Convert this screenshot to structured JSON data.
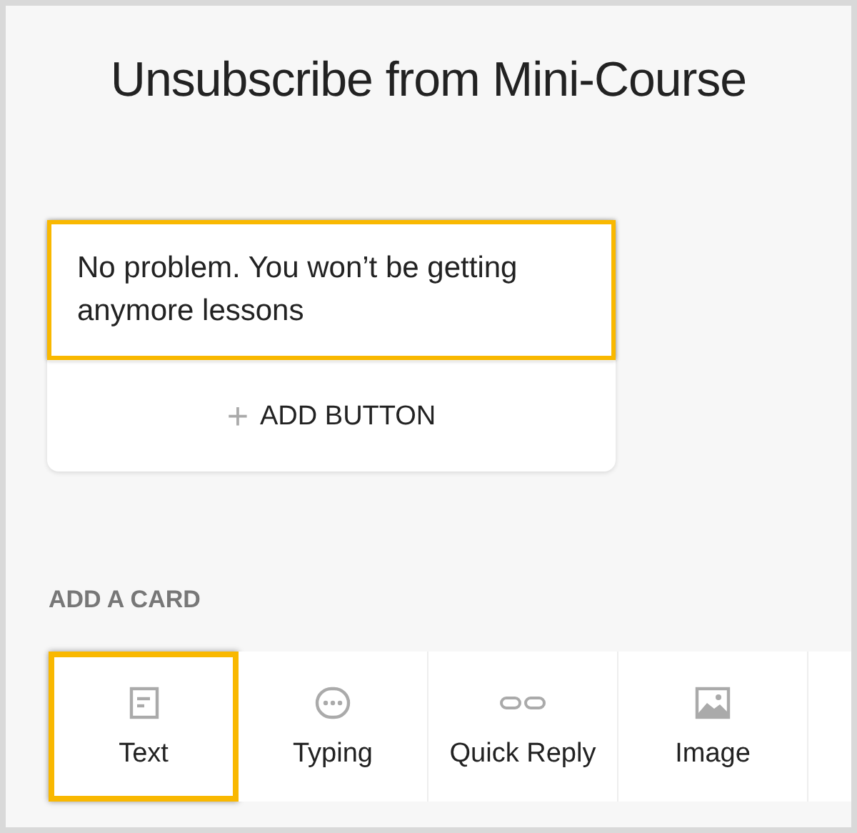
{
  "title": "Unsubscribe from Mini-Course",
  "message_card": {
    "text": "No problem. You won’t be getting anymore lessons",
    "highlighted": true,
    "add_button": {
      "icon": "+",
      "label": "ADD BUTTON"
    }
  },
  "add_card": {
    "heading": "ADD A CARD",
    "types": [
      {
        "kind": "text",
        "label": "Text",
        "highlighted": true
      },
      {
        "kind": "typing",
        "label": "Typing",
        "highlighted": false
      },
      {
        "kind": "quick_reply",
        "label": "Quick Reply",
        "highlighted": false
      },
      {
        "kind": "image",
        "label": "Image",
        "highlighted": false
      }
    ]
  }
}
